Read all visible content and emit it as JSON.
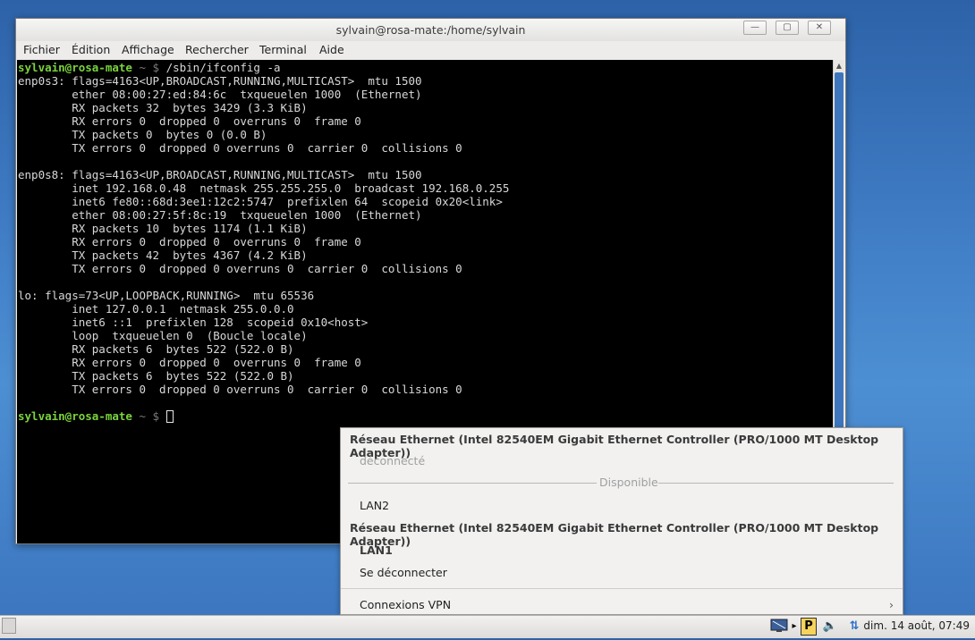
{
  "window": {
    "title": "sylvain@rosa-mate:/home/sylvain",
    "min_glyph": "—",
    "max_glyph": "▢",
    "close_glyph": "✕"
  },
  "menu": [
    "Fichier",
    "Édition",
    "Affichage",
    "Rechercher",
    "Terminal",
    "Aide"
  ],
  "terminal": {
    "prompt_user": "sylvain@rosa-mate",
    "prompt_path": " ~ $ ",
    "command": "/sbin/ifconfig -a",
    "output": "enp0s3: flags=4163<UP,BROADCAST,RUNNING,MULTICAST>  mtu 1500\n        ether 08:00:27:ed:84:6c  txqueuelen 1000  (Ethernet)\n        RX packets 32  bytes 3429 (3.3 KiB)\n        RX errors 0  dropped 0  overruns 0  frame 0\n        TX packets 0  bytes 0 (0.0 B)\n        TX errors 0  dropped 0 overruns 0  carrier 0  collisions 0\n\nenp0s8: flags=4163<UP,BROADCAST,RUNNING,MULTICAST>  mtu 1500\n        inet 192.168.0.48  netmask 255.255.255.0  broadcast 192.168.0.255\n        inet6 fe80::68d:3ee1:12c2:5747  prefixlen 64  scopeid 0x20<link>\n        ether 08:00:27:5f:8c:19  txqueuelen 1000  (Ethernet)\n        RX packets 10  bytes 1174 (1.1 KiB)\n        RX errors 0  dropped 0  overruns 0  frame 0\n        TX packets 42  bytes 4367 (4.2 KiB)\n        TX errors 0  dropped 0 overruns 0  carrier 0  collisions 0\n\nlo: flags=73<UP,LOOPBACK,RUNNING>  mtu 65536\n        inet 127.0.0.1  netmask 255.0.0.0\n        inet6 ::1  prefixlen 128  scopeid 0x10<host>\n        loop  txqueuelen 0  (Boucle locale)\n        RX packets 6  bytes 522 (522.0 B)\n        RX errors 0  dropped 0  overruns 0  frame 0\n        TX packets 6  bytes 522 (522.0 B)\n        TX errors 0  dropped 0 overruns 0  carrier 0  collisions 0\n",
    "prompt2_user": "sylvain@rosa-mate",
    "prompt2_path": " ~ $ "
  },
  "network_menu": {
    "device1_header": "Réseau Ethernet (Intel 82540EM Gigabit Ethernet Controller (PRO/1000 MT Desktop Adapter))",
    "device1_status": "déconnecté",
    "available_label": "Disponible",
    "available_item": "LAN2",
    "device2_header": "Réseau Ethernet (Intel 82540EM Gigabit Ethernet Controller (PRO/1000 MT Desktop Adapter))",
    "active_connection": "LAN1",
    "disconnect": "Se déconnecter",
    "vpn": "Connexions VPN",
    "vpn_arrow": "›"
  },
  "taskbar": {
    "clock": "dim. 14 août, 07:49",
    "parcellite_glyph": "P",
    "volume_glyph": "🔈",
    "network_glyph": "⇅"
  },
  "colors": {
    "prompt": "#7ad33b",
    "accent": "#3e76bd"
  }
}
